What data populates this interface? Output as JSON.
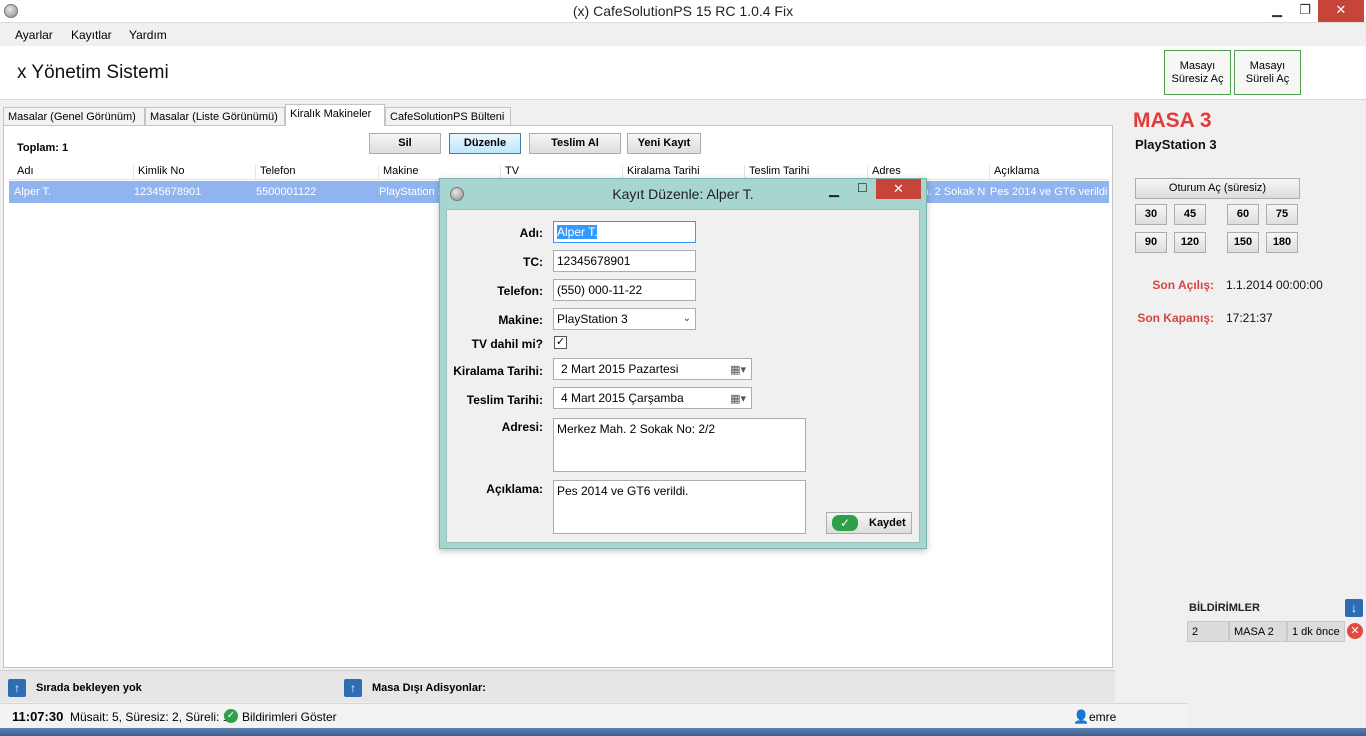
{
  "window": {
    "title": "(x) CafeSolutionPS 15 RC 1.0.4 Fix",
    "min": "▁",
    "max": "❐",
    "close": "✕"
  },
  "menu": [
    "Ayarlar",
    "Kayıtlar",
    "Yardım"
  ],
  "header": {
    "brand": "x Yönetim Sistemi",
    "btn_open_unlimited": "Masayı Süresiz Aç",
    "btn_open_timed": "Masayı Süreli Aç"
  },
  "tabs": [
    "Masalar (Genel Görünüm)",
    "Masalar (Liste Görünümü)",
    "Kiralık Makineler",
    "CafeSolutionPS Bülteni"
  ],
  "main": {
    "total": "Toplam: 1",
    "buttons": {
      "delete": "Sil",
      "edit": "Düzenle",
      "return": "Teslim Al",
      "new": "Yeni Kayıt"
    },
    "columns": [
      "Adı",
      "Kimlik No",
      "Telefon",
      "Makine",
      "TV",
      "Kiralama Tarihi",
      "Teslim Tarihi",
      "Adres",
      "Açıklama"
    ],
    "rows": [
      {
        "name": "Alper T.",
        "id": "12345678901",
        "phone": "5500001122",
        "machine": "PlayStation 3",
        "tv": "",
        "rent": "",
        "return": "",
        "address": "Merkez Mah. 2 Sokak No: 2/2",
        "note": "Pes 2014 ve GT6 verildi."
      }
    ]
  },
  "right": {
    "table": "MASA 3",
    "machine": "PlayStation 3",
    "session_btn": "Oturum Aç (süresiz)",
    "durations": [
      "30",
      "45",
      "60",
      "75",
      "90",
      "120",
      "150",
      "180"
    ],
    "last_open_label": "Son Açılış:",
    "last_open_value": "1.1.2014 00:00:00",
    "last_close_label": "Son Kapanış:",
    "last_close_value": "17:21:37",
    "notifications_title": "BİLDİRİMLER",
    "notification": {
      "no": "2",
      "table": "MASA 2",
      "time": "1 dk önce"
    }
  },
  "bottom": {
    "queue": "Sırada bekleyen yok",
    "outside": "Masa Dışı Adisyonlar:",
    "clock": "11:07:30",
    "status": "Müsait: 5, Süresiz: 2, Süreli: 1",
    "show_notifications": "Bildirimleri Göster",
    "user": "emre"
  },
  "dialog": {
    "title": "Kayıt Düzenle: Alper T.",
    "labels": {
      "name": "Adı:",
      "tc": "TC:",
      "phone": "Telefon:",
      "machine": "Makine:",
      "tv": "TV dahil mi?",
      "rent_date": "Kiralama Tarihi:",
      "return_date": "Teslim Tarihi:",
      "address": "Adresi:",
      "note": "Açıklama:"
    },
    "values": {
      "name": "Alper T.",
      "tc": "12345678901",
      "phone": "(550) 000-11-22",
      "machine": "PlayStation 3",
      "tv_checked": "✓",
      "rent_date": "2    Mart    2015  Pazartesi",
      "return_date": "4    Mart    2015 Çarşamba",
      "address": "Merkez Mah. 2 Sokak No: 2/2",
      "note": "Pes 2014 ve GT6 verildi."
    },
    "save": "Kaydet"
  }
}
